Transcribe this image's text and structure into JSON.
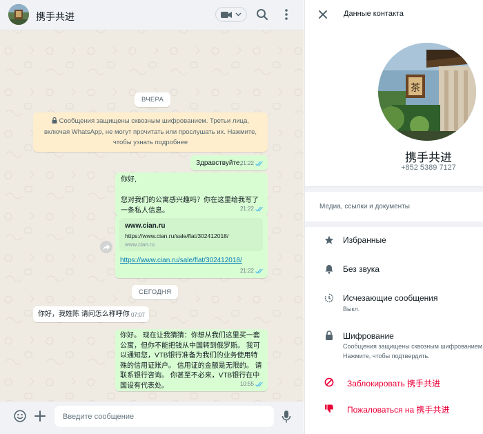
{
  "chat_header": {
    "title": "携手共进"
  },
  "messages": {
    "date_yesterday": "ВЧЕРА",
    "encryption_notice": "Сообщения защищены сквозным шифрованием. Третьи лица, включая WhatsApp, не могут прочитать или прослушать их. Нажмите, чтобы узнать подробнее",
    "msg1": {
      "text": "Здравствуйте,",
      "time": "21:22"
    },
    "msg2": {
      "text": "你好,\n\n您对我们的公寓感兴趣吗？你在这里给我写了一条私人信息。",
      "time": "21:22"
    },
    "msg3": {
      "preview_domain": "www.cian.ru",
      "preview_url": "https://www.cian.ru/sale/flat/302412018/",
      "preview_host": "www.cian.ru",
      "link": "https://www.cian.ru/sale/flat/302412018/",
      "time": "21:22"
    },
    "date_today": "СЕГОДНЯ",
    "msg4": {
      "text": "你好，我姓陈 请问怎么称呼你",
      "time": "07:07"
    },
    "msg5": {
      "text": "你好。 现在让我猜猜：你想从我们这里买一套公寓，但你不能把钱从中国转到俄罗斯。 我可以通知您，VTB银行准备为我们的业务使用特殊的信用证账户。 信用证的金额是无限的。 请联系银行咨询。 你甚至不必来，VTB银行在中国设有代表处。",
      "time": "10:55"
    }
  },
  "composer": {
    "placeholder": "Введите сообщение"
  },
  "contact_info": {
    "title": "Данные контакта",
    "name": "携手共进",
    "phone": "+852 5389 7127",
    "media_label": "Медиа, ссылки и документы",
    "starred": "Избранные",
    "mute": "Без звука",
    "disappearing": "Исчезающие сообщения",
    "disappearing_value": "Выкл.",
    "encryption": "Шифрование",
    "encryption_sub1": "Сообщения защищены сквозным шифрованием.",
    "encryption_sub2": "Нажмите, чтобы подтвердить.",
    "block": "Заблокировать 携手共进",
    "report": "Пожаловаться на 携手共进"
  },
  "colors": {
    "outgoing_bubble": "#d9fdd3",
    "incoming_bubble": "#ffffff",
    "danger": "#ea0038",
    "link": "#027eb5",
    "read_ticks": "#53bdeb"
  },
  "icons": [
    "avatar",
    "video-call-icon",
    "chevron-down-icon",
    "search-icon",
    "menu-icon",
    "lock-icon",
    "double-tick-icon",
    "forward-icon",
    "emoji-icon",
    "plus-icon",
    "mic-icon",
    "close-icon",
    "star-icon",
    "bell-icon",
    "timer-icon",
    "lock-icon",
    "block-icon",
    "thumbs-down-icon"
  ]
}
